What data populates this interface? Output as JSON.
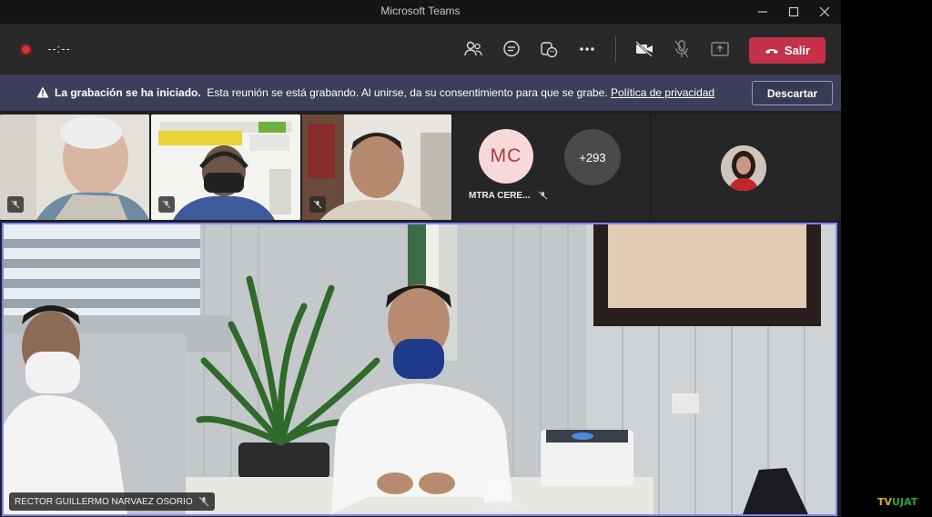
{
  "window": {
    "title": "Microsoft Teams"
  },
  "toolbar": {
    "timer": "--:--",
    "leave_label": "Salir",
    "buttons": [
      "people-icon",
      "chat-icon",
      "reactions-icon",
      "more-icon",
      "camera-off-icon",
      "mic-off-icon",
      "share-icon"
    ]
  },
  "banner": {
    "title": "La grabación se ha iniciado.",
    "message": "Esta reunión se está grabando. Al unirse, da su consentimiento para que se grabe.",
    "link": "Política de privacidad",
    "dismiss_label": "Descartar"
  },
  "participants": {
    "mc_initials": "MC",
    "mc_name": "MTRA CERE...",
    "more_count": "+293"
  },
  "main_video": {
    "speaker_name": "RECTOR GUILLERMO NARVAEZ OSORIO"
  },
  "watermark": {
    "tv": "TV",
    "ujat": "UJAT"
  },
  "colors": {
    "leave": "#c4314b",
    "banner": "#3d3d5c",
    "active_border": "#7f85f5",
    "recording": "#d3323e"
  }
}
